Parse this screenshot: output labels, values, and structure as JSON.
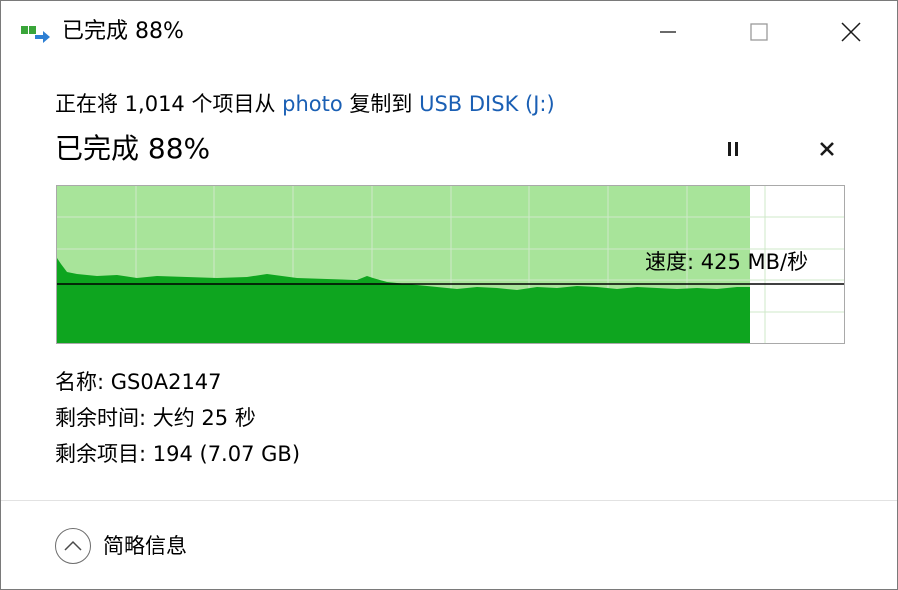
{
  "title_bar": {
    "title": "已完成 88%",
    "icon": "copy-transfer-icon",
    "minimize_icon": "minimize-icon",
    "maximize_icon": "maximize-icon",
    "close_icon": "close-icon"
  },
  "copy_info": {
    "prefix": "正在将 1,014 个项目从 ",
    "source": "photo",
    "middle": " 复制到 ",
    "destination": "USB DISK (J:)"
  },
  "progress": {
    "label": "已完成 88%",
    "percent": 88,
    "pause_icon": "pause-icon",
    "cancel_icon": "cancel-icon"
  },
  "speed": {
    "label": "速度: 425 MB/秒"
  },
  "details": {
    "name": "名称: GS0A2147",
    "time_remaining": "剩余时间: 大约 25 秒",
    "items_remaining": "剩余项目: 194 (7.07 GB)"
  },
  "footer": {
    "toggle_label": "简略信息",
    "toggle_icon": "chevron-up-icon"
  },
  "colors": {
    "accent_link": "#1a5fb4",
    "progress_light_green": "#a8e49a",
    "throughput_green": "#0ea51f",
    "grid_line": "#cfe9ca",
    "speed_line": "#000000"
  }
}
